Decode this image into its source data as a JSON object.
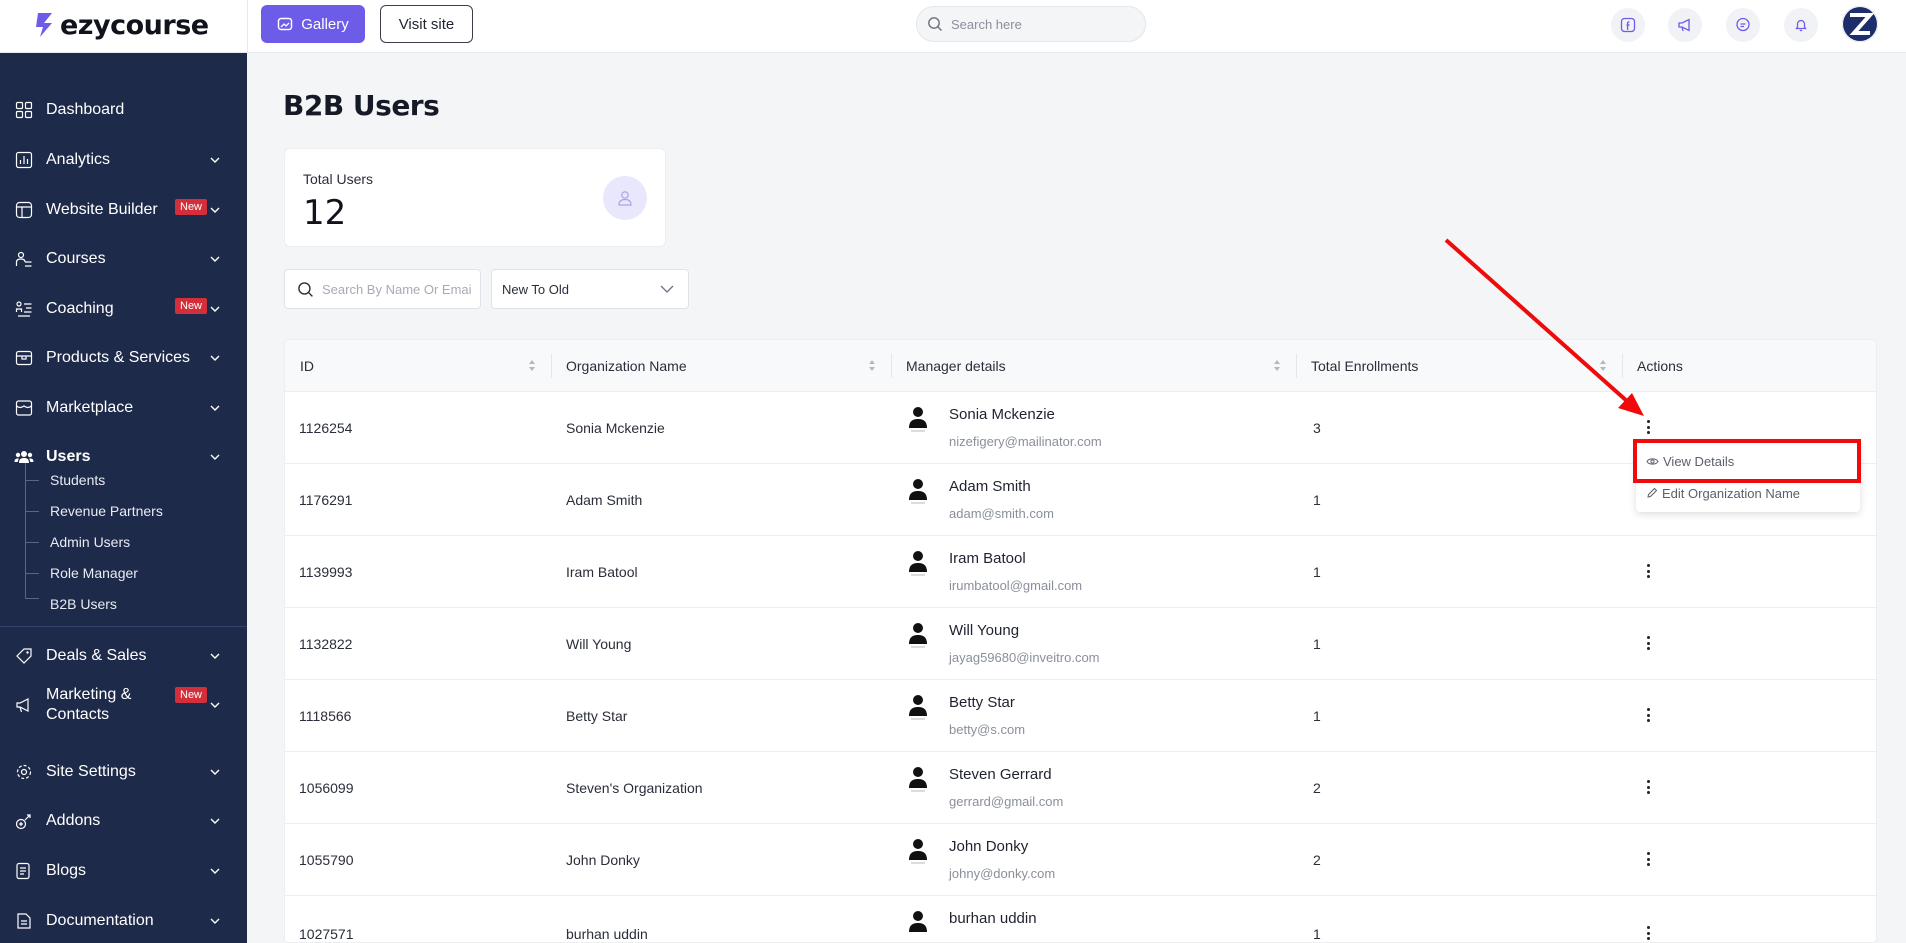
{
  "brand": {
    "name": "ezycourse"
  },
  "topbar": {
    "gallery_label": "Gallery",
    "visit_label": "Visit site",
    "search_placeholder": "Search here",
    "icons": [
      "facebook-icon",
      "megaphone-icon",
      "chat-icon",
      "bell-icon"
    ]
  },
  "sidebar": {
    "items": [
      {
        "label": "Dashboard",
        "icon": "dashboard-icon"
      },
      {
        "label": "Analytics",
        "icon": "analytics-icon"
      },
      {
        "label": "Website Builder",
        "icon": "website-builder-icon",
        "badge": "New"
      },
      {
        "label": "Courses",
        "icon": "courses-icon"
      },
      {
        "label": "Coaching",
        "icon": "coaching-icon",
        "badge": "New"
      },
      {
        "label": "Products & Services",
        "icon": "products-icon"
      },
      {
        "label": "Marketplace",
        "icon": "marketplace-icon"
      },
      {
        "label": "Users",
        "icon": "users-icon"
      },
      {
        "label": "Deals & Sales",
        "icon": "tag-icon"
      },
      {
        "label": "Marketing &",
        "label2": "Contacts",
        "icon": "megaphone-icon",
        "badge": "New"
      },
      {
        "label": "Site Settings",
        "icon": "settings-icon"
      },
      {
        "label": "Addons",
        "icon": "addons-icon"
      },
      {
        "label": "Blogs",
        "icon": "blogs-icon"
      },
      {
        "label": "Documentation",
        "icon": "documentation-icon"
      }
    ],
    "users_sub": [
      "Students",
      "Revenue Partners",
      "Admin Users",
      "Role Manager",
      "B2B Users"
    ]
  },
  "page": {
    "title": "B2B Users",
    "stat_label": "Total Users",
    "stat_value": "12",
    "search_placeholder": "Search By Name Or Email",
    "sort_value": "New To Old"
  },
  "table": {
    "headers": [
      "ID",
      "Organization Name",
      "Manager details",
      "Total Enrollments",
      "Actions"
    ],
    "rows": [
      {
        "id": "1126254",
        "org": "Sonia Mckenzie",
        "name": "Sonia Mckenzie",
        "email": "nizefigery@mailinator.com",
        "enrollments": "3"
      },
      {
        "id": "1176291",
        "org": "Adam Smith",
        "name": "Adam Smith",
        "email": "adam@smith.com",
        "enrollments": "1"
      },
      {
        "id": "1139993",
        "org": "Iram Batool",
        "name": "Iram Batool",
        "email": "irumbatool@gmail.com",
        "enrollments": "1"
      },
      {
        "id": "1132822",
        "org": "Will Young",
        "name": "Will Young",
        "email": "jayag59680@inveitro.com",
        "enrollments": "1"
      },
      {
        "id": "1118566",
        "org": "Betty Star",
        "name": "Betty Star",
        "email": "betty@s.com",
        "enrollments": "1"
      },
      {
        "id": "1056099",
        "org": "Steven's Organization",
        "name": "Steven Gerrard",
        "email": "gerrard@gmail.com",
        "enrollments": "2"
      },
      {
        "id": "1055790",
        "org": "John Donky",
        "name": "John Donky",
        "email": "johny@donky.com",
        "enrollments": "2"
      },
      {
        "id": "1027571",
        "org": "burhan uddin",
        "name": "burhan uddin",
        "email": "",
        "enrollments": "1"
      }
    ]
  },
  "dropdown": {
    "view_details": "View Details",
    "edit_org": "Edit Organization Name"
  },
  "colors": {
    "accent": "#6c5ce7",
    "sidebar": "#1e2a4a",
    "highlight": "#ef0b0b",
    "badge": "#d32f3a"
  }
}
